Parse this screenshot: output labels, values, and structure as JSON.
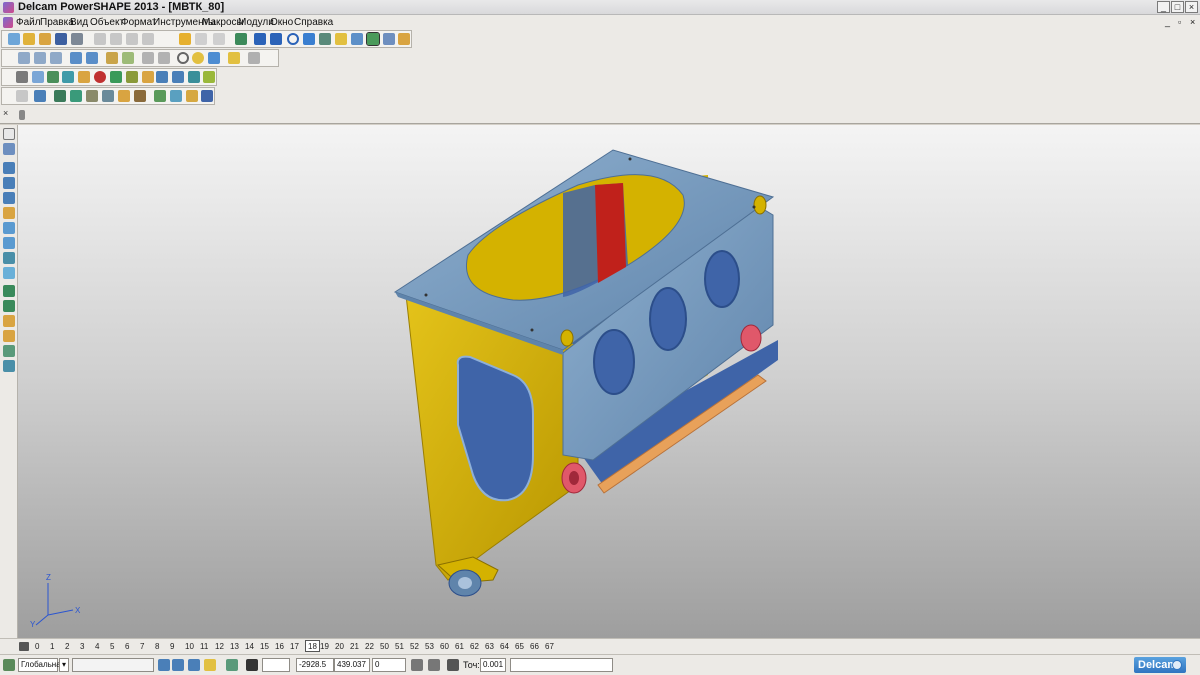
{
  "window": {
    "title": "Delcam PowerSHAPE 2013 - [МВТК_80]",
    "controls": [
      "_",
      "□",
      "×"
    ],
    "doc_controls": [
      "_",
      "▫",
      "×"
    ]
  },
  "menu": {
    "items": [
      "Файл",
      "Правка",
      "Вид",
      "Объект",
      "Формат",
      "Инструменты",
      "Макросы",
      "Модули",
      "Окно",
      "Справка"
    ]
  },
  "model": {
    "colors": {
      "plate_blue": "#6f93b8",
      "side_yellow": "#d4b200",
      "red_part": "#c0211b",
      "dark_blue": "#3f64a8",
      "orange_rail": "#e8a15a",
      "pink_boss": "#e0586a"
    }
  },
  "axis": {
    "x": "X",
    "y": "Y",
    "z": "Z"
  },
  "levels": {
    "icon": "levels-icon",
    "items": [
      "0",
      "1",
      "2",
      "3",
      "4",
      "5",
      "6",
      "7",
      "8",
      "9",
      "10",
      "11",
      "12",
      "13",
      "14",
      "15",
      "16",
      "17",
      "18",
      "19",
      "20",
      "21",
      "22",
      "50",
      "51",
      "52",
      "53",
      "60",
      "61",
      "62",
      "63",
      "64",
      "65",
      "66",
      "67"
    ],
    "active": "18"
  },
  "status": {
    "workplane": "Глобальна",
    "x": "-2928.5",
    "y": "439.037",
    "z": "0",
    "tolerance_label": "Точ:",
    "tolerance": "0.001",
    "brand": "Delcam"
  }
}
